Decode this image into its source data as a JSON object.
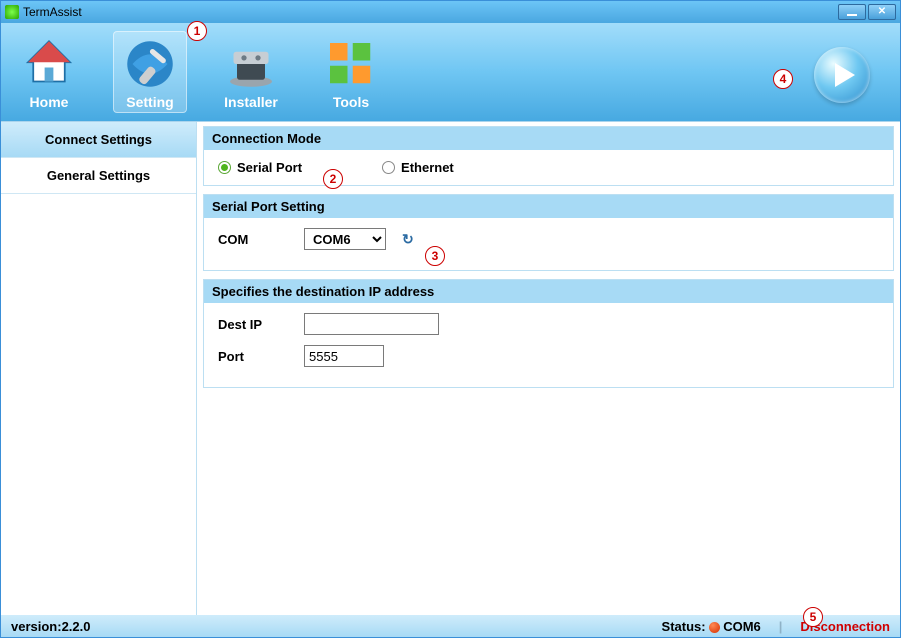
{
  "app": {
    "title": "TermAssist"
  },
  "toolbar": {
    "items": [
      {
        "label": "Home"
      },
      {
        "label": "Setting"
      },
      {
        "label": "Installer"
      },
      {
        "label": "Tools"
      }
    ]
  },
  "sidebar": {
    "items": [
      {
        "label": "Connect Settings"
      },
      {
        "label": "General Settings"
      }
    ]
  },
  "panels": {
    "connMode": {
      "header": "Connection Mode",
      "options": {
        "serial": "Serial Port",
        "ethernet": "Ethernet"
      }
    },
    "serialPort": {
      "header": "Serial Port Setting",
      "comLabel": "COM",
      "comValue": "COM6"
    },
    "destIp": {
      "header": "Specifies the destination IP address",
      "destIpLabel": "Dest IP",
      "destIpValue": "",
      "portLabel": "Port",
      "portValue": "5555"
    }
  },
  "status": {
    "versionLabel": "version:",
    "version": "2.2.0",
    "statusLabel": "Status:",
    "port": "COM6",
    "connState": "Disconnection"
  },
  "annotations": {
    "a1": "1",
    "a2": "2",
    "a3": "3",
    "a4": "4",
    "a5": "5"
  }
}
